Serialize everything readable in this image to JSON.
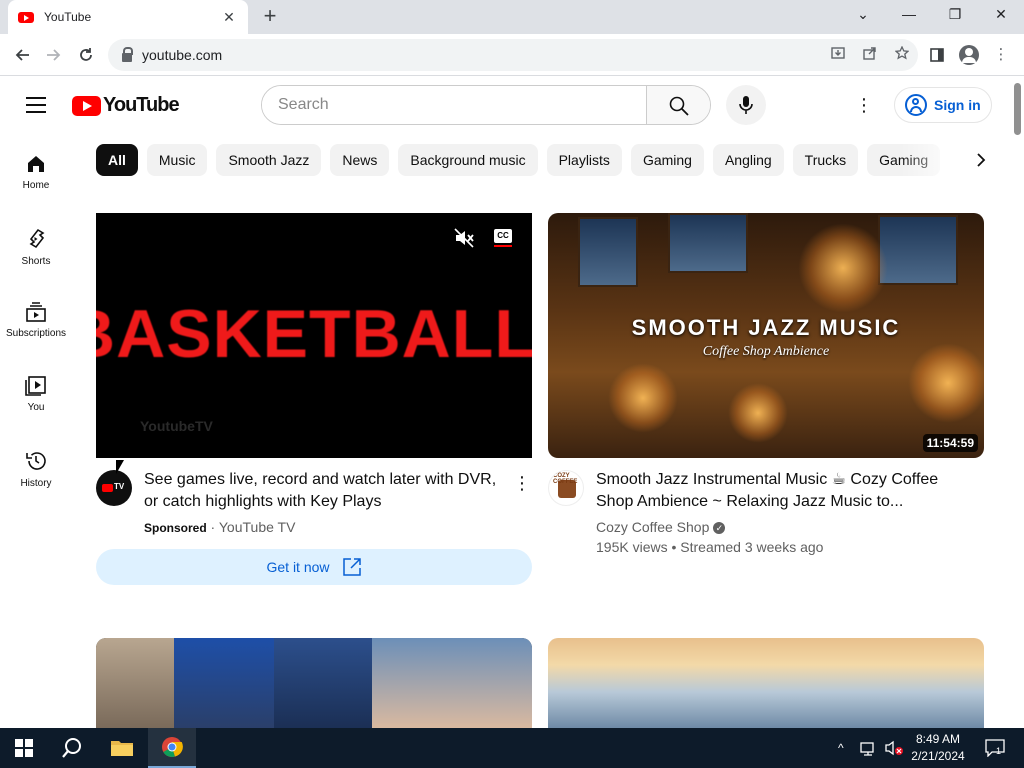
{
  "browser": {
    "tab_title": "YouTube",
    "tab_close": "✕",
    "new_tab": "+",
    "url": "youtube.com",
    "win_controls": {
      "tab_search": "⌄",
      "minimize": "—",
      "restore": "❐",
      "close": "✕"
    }
  },
  "masthead": {
    "logo_text": "YouTube",
    "search_placeholder": "Search",
    "more": "⋮",
    "sign_in": "Sign in"
  },
  "guide": {
    "items": [
      {
        "label": "Home",
        "icon": "home-icon"
      },
      {
        "label": "Shorts",
        "icon": "shorts-icon"
      },
      {
        "label": "Subscriptions",
        "icon": "subscriptions-icon"
      },
      {
        "label": "You",
        "icon": "you-icon"
      },
      {
        "label": "History",
        "icon": "history-icon"
      }
    ]
  },
  "chips": [
    "All",
    "Music",
    "Smooth Jazz",
    "News",
    "Background music",
    "Playlists",
    "Gaming",
    "Angling",
    "Trucks",
    "Gaming"
  ],
  "chip_next": "›",
  "ad": {
    "thumb_text": "BASKETBALL",
    "watermark": "YoutubeTV",
    "cc": "CC",
    "title": "See games live, record and watch later with DVR, or catch highlights with Key Plays",
    "sponsored": "Sponsored",
    "separator": " · ",
    "advertiser": "YouTube TV",
    "cta": "Get it now",
    "menu": "⋮",
    "avatar_text": "TV"
  },
  "video1": {
    "thumb_title": "SMOOTH JAZZ MUSIC",
    "thumb_subtitle": "Coffee Shop Ambience",
    "duration": "11:54:59",
    "title": "Smooth Jazz Instrumental Music ☕ Cozy Coffee Shop Ambience ~ Relaxing Jazz Music to...",
    "channel": "Cozy Coffee Shop",
    "verified": "✓",
    "stats": "195K views • Streamed 3 weeks ago",
    "avatar_text": "COZY COFFEE"
  },
  "taskbar": {
    "time": "8:49 AM",
    "date": "2/21/2024",
    "tray_chevron": "^",
    "notifications": "1"
  },
  "colors": {
    "brand_red": "#ff0000",
    "link_blue": "#065fd4",
    "cta_bg": "#def1ff",
    "taskbar": "#0d1b2a"
  }
}
